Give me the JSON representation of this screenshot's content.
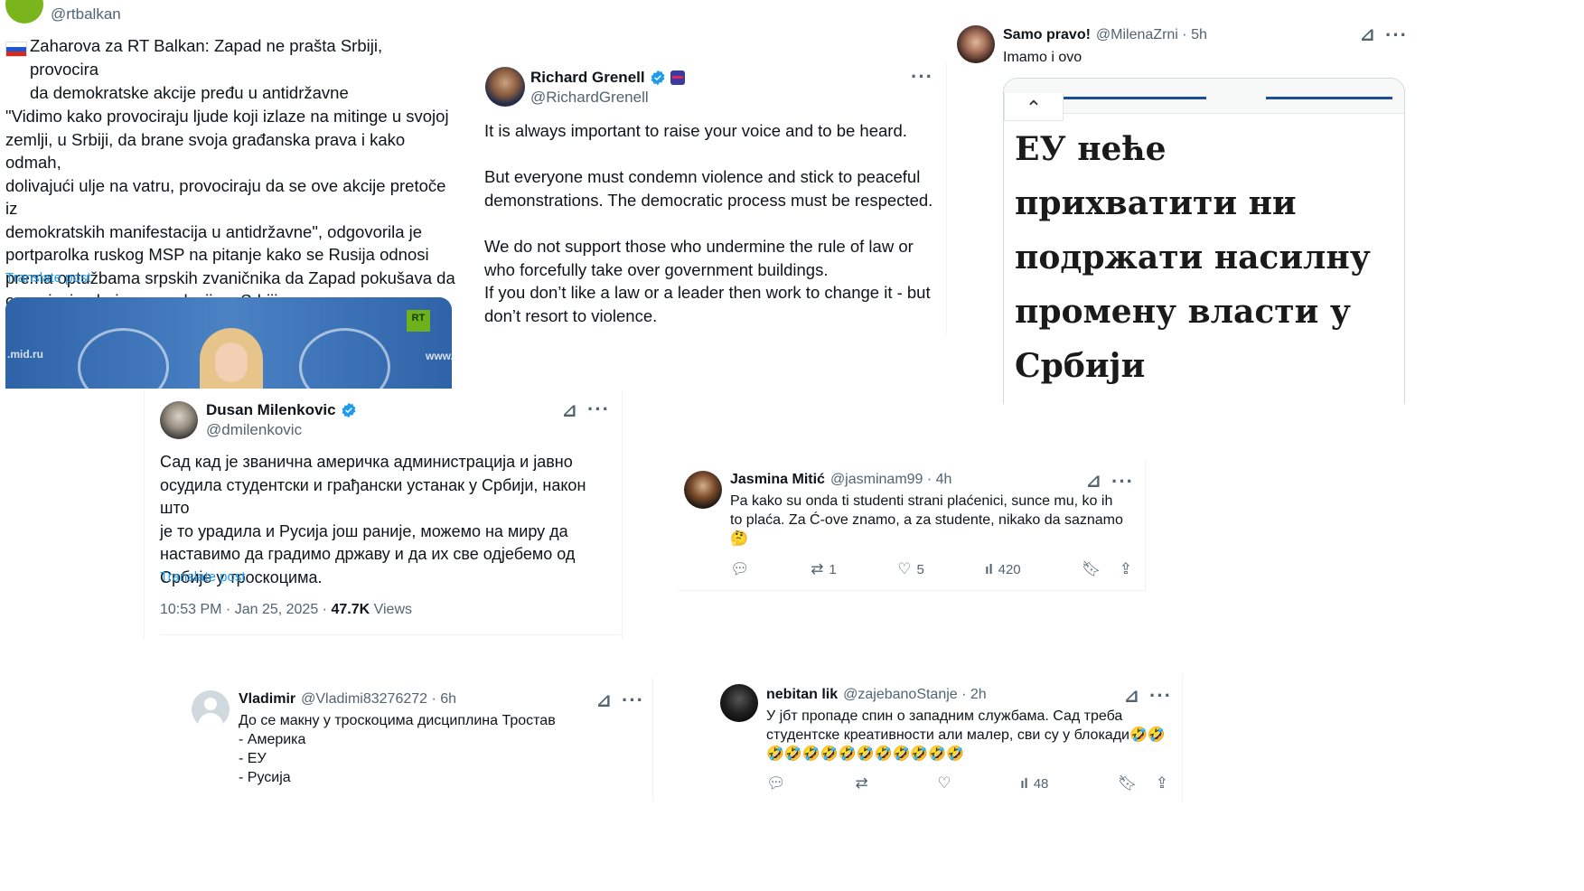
{
  "rt_post": {
    "handle": "@rtbalkan",
    "flag_icon": "russia-flag-icon",
    "headline": "Zaharova za RT Balkan: Zapad ne prašta Srbiji, provocira\nda demokratske akcije pređu u antidržavne",
    "body": "\"Vidimo kako provociraju ljude koji izlaze na mitinge u svojoj\nzemlji, u Srbiji, da brane svoja građanska prava i kako odmah,\ndolivajući ulje na vatru, provociraju da se ove akcije pretoče iz\ndemokratskih manifestacija u antidržavne\", odgovorila je\nportparolka ruskog MSP na pitanje kako se Rusija odnosi\nprema optužbama srpskih zvaničnika da Zapad pokušava da\norganizuje obojenu revoluciju u Srbiji.",
    "translate": "Translate post",
    "image_left_text": ".mid.ru",
    "image_right_text": "www.",
    "logo_text": "RT"
  },
  "grenell_post": {
    "name": "Richard Grenell",
    "handle": "@RichardGrenell",
    "p1": "It is always important to raise your voice and to be heard.",
    "p2": "But everyone must condemn violence and stick to peaceful\ndemonstrations. The democratic process must be respected.",
    "p3": "We do not support those who undermine the rule of law or\nwho forcefully take over government buildings.\nIf you don’t like a law or a leader then work to change it - but\ndon’t resort to violence."
  },
  "samo_post": {
    "name": "Samo pravo!",
    "meta": "@MilenaZrni · 5h",
    "text": "Imamo i ovo",
    "big_text": "ЕУ неће\nприхватити ни\nподржати насилну\nпромену власти у\nСрбији"
  },
  "dusan_post": {
    "name": "Dusan Milenkovic",
    "handle": "@dmilenkovic",
    "body": "Сад кад је званична америчка администрација и јавно\nосудила студентски и грађански устанак у Србији, након што\nје то урадила и Русија још раније, можемо на миру да\nнаставимо да градимо државу и да их све одјебемо од\nСрбије у троскоцима.",
    "translate": "Translate post",
    "time": "10:53 PM · Jan 25, 2025 · ",
    "views_count": "47.7K",
    "views_label": " Views"
  },
  "jasmina_post": {
    "name": "Jasmina Mitić",
    "meta": "@jasminam99 · 4h",
    "body": "Pa kako su onda ti studenti strani plaćenici, sunce mu, ko ih\nto plaća. Za Ć-ove znamo, a za studente, nikako da saznamo\n🤔",
    "retweets": "1",
    "likes": "5",
    "views": "420"
  },
  "vladimir_post": {
    "name": "Vladimir",
    "meta": "@Vladimi83276272 · 6h",
    "body": "До се макну у троскоцима дисциплина Тростав\n- Америка\n- ЕУ\n- Русија"
  },
  "nebitan_post": {
    "name": "nebitan lik",
    "meta": "@zajebanoStanje · 2h",
    "body": "У јбт пропаде спин о западним службама. Сад треба\nстудентске креативности али малер, сви су у блокади🤣🤣\n🤣🤣🤣🤣🤣🤣🤣🤣🤣🤣🤣",
    "views": "48"
  },
  "colors": {
    "link": "#1d9bf0",
    "muted": "#536471",
    "verified": "#1d9bf0",
    "rt_green": "#7ab51d"
  }
}
